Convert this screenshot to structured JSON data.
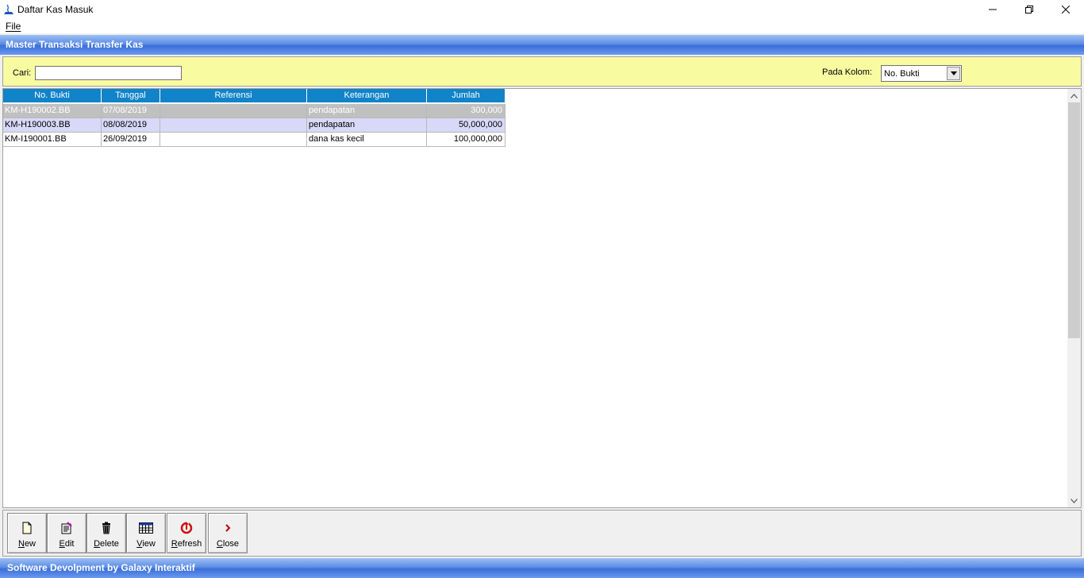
{
  "window": {
    "title": "Daftar Kas Masuk"
  },
  "menu": {
    "file": "File"
  },
  "header": {
    "title": "Master Transaksi Transfer Kas"
  },
  "search": {
    "label": "Cari:",
    "value": "",
    "column_label": "Pada Kolom:",
    "column_selected": "No. Bukti"
  },
  "table": {
    "columns": [
      "No. Bukti",
      "Tanggal",
      "Referensi",
      "Keterangan",
      "Jumlah"
    ],
    "rows": [
      [
        "KM-H190002.BB",
        "07/08/2019",
        "",
        "pendapatan",
        "300,000"
      ],
      [
        "KM-H190003.BB",
        "08/08/2019",
        "",
        "pendapatan",
        "50,000,000"
      ],
      [
        "KM-I190001.BB",
        "26/09/2019",
        "",
        "dana kas kecil",
        "100,000,000"
      ]
    ]
  },
  "toolbar": {
    "new": "New",
    "edit": "Edit",
    "delete": "Delete",
    "view": "View",
    "refresh": "Refresh",
    "close": "Close"
  },
  "footer": {
    "text": "Software Devolpment by Galaxy Interaktif"
  },
  "colors": {
    "header_blue": "#3a6fd9",
    "column_header": "#1083c9",
    "search_panel": "#f8fba0",
    "selected_row": "#c0c0c0",
    "alt_row": "#d8d8f8"
  }
}
